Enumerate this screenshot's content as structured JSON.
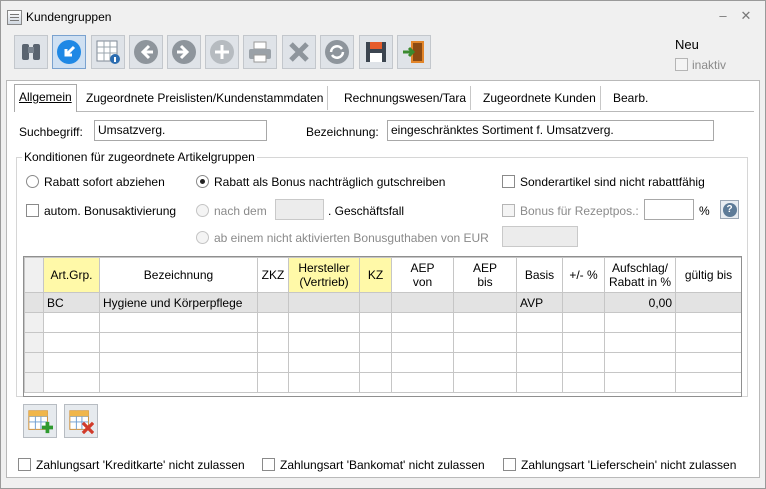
{
  "window": {
    "title": "Kundengruppen",
    "minimize": "–",
    "close": "✕"
  },
  "toolbar": [
    {
      "name": "binoculars-icon"
    },
    {
      "name": "back-arrow-icon"
    },
    {
      "name": "grid-info-icon"
    },
    {
      "name": "prev-icon"
    },
    {
      "name": "next-icon"
    },
    {
      "name": "add-icon"
    },
    {
      "name": "print-icon"
    },
    {
      "name": "delete-icon"
    },
    {
      "name": "refresh-icon"
    },
    {
      "name": "save-icon"
    },
    {
      "name": "exit-icon"
    }
  ],
  "status": {
    "neu": "Neu",
    "inaktiv": "inaktiv"
  },
  "tabs": [
    "Allgemein",
    "Zugeordnete Preislisten/Kundenstammdaten",
    "Rechnungswesen/Tara",
    "Zugeordnete Kunden",
    "Bearb."
  ],
  "form": {
    "suchbegriff_label": "Suchbegriff:",
    "suchbegriff_value": "Umsatzverg.",
    "bezeichnung_label": "Bezeichnung:",
    "bezeichnung_value": "eingeschränktes Sortiment f. Umsatzverg."
  },
  "conditions": {
    "title": "Konditionen für zugeordnete Artikelgruppen",
    "rabatt_sofort": "Rabatt sofort abziehen",
    "rabatt_bonus": "Rabatt als Bonus nachträglich gutschreiben",
    "sonderartikel": "Sonderartikel sind nicht rabattfähig",
    "autom_bonus": "autom. Bonusaktivierung",
    "nach_dem": "nach dem",
    "geschaeftsfall": ". Geschäftsfall",
    "bonus_rezept": "Bonus für Rezeptpos.:",
    "percent": "%",
    "ab_einem": "ab einem nicht aktivierten Bonusguthaben von EUR",
    "help": "?"
  },
  "grid": {
    "columns": [
      "Art.Grp.",
      "Bezeichnung",
      "ZKZ",
      "Hersteller\n(Vertrieb)",
      "KZ",
      "AEP\nvon",
      "AEP\nbis",
      "Basis",
      "+/- %",
      "Aufschlag/\nRabatt in %",
      "gültig bis"
    ],
    "rows": [
      [
        "BC",
        "Hygiene und Körperpflege",
        "",
        "",
        "",
        "",
        "",
        "AVP",
        "",
        "0,00",
        ""
      ],
      [
        "",
        "",
        "",
        "",
        "",
        "",
        "",
        "",
        "",
        "",
        ""
      ],
      [
        "",
        "",
        "",
        "",
        "",
        "",
        "",
        "",
        "",
        "",
        ""
      ],
      [
        "",
        "",
        "",
        "",
        "",
        "",
        "",
        "",
        "",
        "",
        ""
      ],
      [
        "",
        "",
        "",
        "",
        "",
        "",
        "",
        "",
        "",
        "",
        ""
      ]
    ]
  },
  "footer": {
    "kreditkarte": "Zahlungsart 'Kreditkarte' nicht zulassen",
    "bankomat": "Zahlungsart 'Bankomat' nicht zulassen",
    "lieferschein": "Zahlungsart 'Lieferschein' nicht zulassen"
  }
}
